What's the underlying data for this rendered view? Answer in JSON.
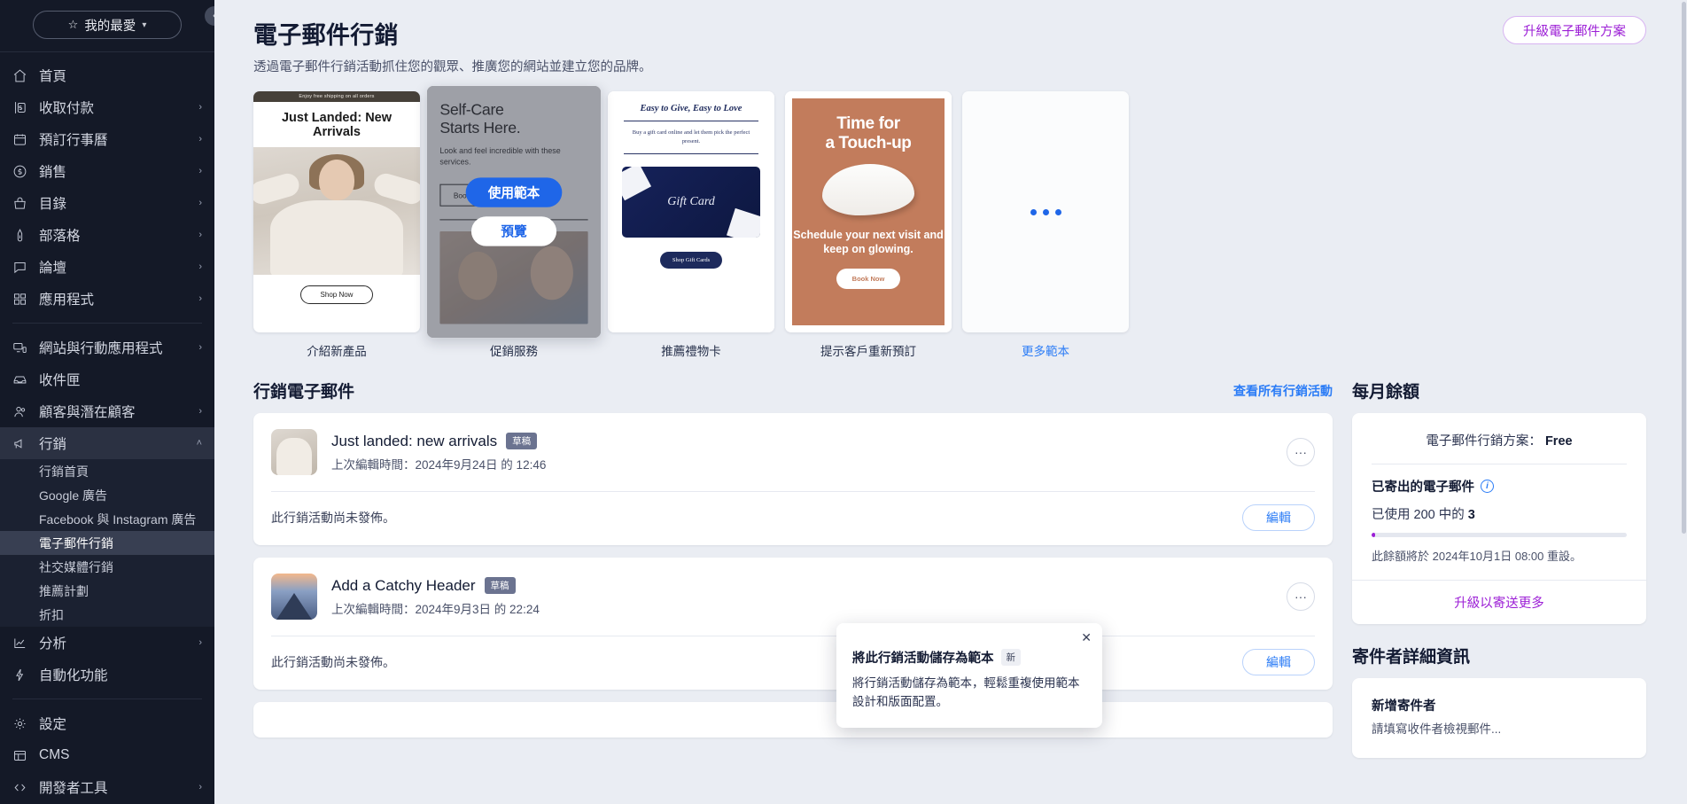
{
  "sidebar": {
    "favorites_label": "我的最愛",
    "favorites_icon": "star-icon",
    "collapse_icon": "chevron-left-icon",
    "items": [
      {
        "label": "首頁",
        "icon": "home-icon",
        "expandable": false
      },
      {
        "label": "收取付款",
        "icon": "receive-payment-icon",
        "expandable": true
      },
      {
        "label": "預訂行事曆",
        "icon": "calendar-icon",
        "expandable": true
      },
      {
        "label": "銷售",
        "icon": "dollar-circle-icon",
        "expandable": true
      },
      {
        "label": "目錄",
        "icon": "catalog-icon",
        "expandable": true
      },
      {
        "label": "部落格",
        "icon": "pen-icon",
        "expandable": true
      },
      {
        "label": "論壇",
        "icon": "forum-icon",
        "expandable": true
      },
      {
        "label": "應用程式",
        "icon": "apps-grid-icon",
        "expandable": true
      }
    ],
    "items2": [
      {
        "label": "網站與行動應用程式",
        "icon": "monitor-mobile-icon",
        "expandable": true
      },
      {
        "label": "收件匣",
        "icon": "inbox-icon",
        "expandable": false
      },
      {
        "label": "顧客與潛在顧客",
        "icon": "people-icon",
        "expandable": true
      },
      {
        "label": "行銷",
        "icon": "megaphone-icon",
        "expandable": true,
        "expanded": true,
        "active": true
      }
    ],
    "marketing_subitems": [
      {
        "label": "行銷首頁",
        "active": false
      },
      {
        "label": "Google 廣告",
        "active": false
      },
      {
        "label": "Facebook 與 Instagram 廣告",
        "active": false
      },
      {
        "label": "電子郵件行銷",
        "active": true
      },
      {
        "label": "社交媒體行銷",
        "active": false
      },
      {
        "label": "推薦計劃",
        "active": false
      },
      {
        "label": "折扣",
        "active": false
      }
    ],
    "items3": [
      {
        "label": "分析",
        "icon": "analytics-icon",
        "expandable": true
      },
      {
        "label": "自動化功能",
        "icon": "automation-bolt-icon",
        "expandable": false
      }
    ],
    "items4": [
      {
        "label": "設定",
        "icon": "gear-icon",
        "expandable": false
      },
      {
        "label": "CMS",
        "icon": "table-icon",
        "expandable": false
      },
      {
        "label": "開發者工具",
        "icon": "code-icon",
        "expandable": true
      }
    ]
  },
  "header": {
    "title": "電子郵件行銷",
    "subtitle": "透過電子郵件行銷活動抓住您的觀眾、推廣您的網站並建立您的品牌。",
    "upgrade_button": "升級電子郵件方案"
  },
  "templates": {
    "use_template_button": "使用範本",
    "preview_button": "預覽",
    "cards": [
      {
        "caption": "介紹新產品",
        "topbar": "Enjoy free shipping on all orders",
        "heading": "Just Landed: New Arrivals",
        "cta": "Shop Now"
      },
      {
        "caption": "促銷服務",
        "heading_line1": "Self-Care",
        "heading_line2": "Starts Here.",
        "body": "Look and feel incredible with these services.",
        "cta": "Book Now",
        "hovered": true
      },
      {
        "caption": "推薦禮物卡",
        "heading": "Easy to Give, Easy to Love",
        "body": "Buy a gift card online and let them pick the perfect present.",
        "card_text": "Gift Card",
        "cta": "Shop Gift Cards"
      },
      {
        "caption": "提示客戶重新預訂",
        "heading_line1": "Time for",
        "heading_line2": "a Touch-up",
        "body": "Schedule your next visit and keep on glowing.",
        "cta": "Book Now"
      },
      {
        "caption": "更多範本",
        "is_link": true,
        "loading": true
      }
    ]
  },
  "campaigns_section": {
    "title": "行銷電子郵件",
    "view_all_link": "查看所有行銷活動",
    "items": [
      {
        "name": "Just landed: new arrivals",
        "badge": "草稿",
        "meta": "上次編輯時間：2024年9月24日 的 12:46",
        "status": "此行銷活動尚未發佈。",
        "edit_button": "編輯",
        "more_icon": "ellipsis-icon"
      },
      {
        "name": "Add a Catchy Header",
        "badge": "草稿",
        "meta": "上次編輯時間：2024年9月3日 的 22:24",
        "status": "此行銷活動尚未發佈。",
        "edit_button": "編輯",
        "more_icon": "ellipsis-icon"
      }
    ]
  },
  "balance_panel": {
    "title": "每月餘額",
    "plan_label": "電子郵件行銷方案：",
    "plan_value": "Free",
    "sent_label": "已寄出的電子郵件",
    "info_icon": "info-icon",
    "used_prefix": "已使用 200 中的",
    "used_value": "3",
    "used_total": 200,
    "used_count": 3,
    "progress_percent": 1.5,
    "reset_note": "此餘額將於 2024年10月1日 08:00 重設。",
    "upgrade_link": "升級以寄送更多",
    "accent_color": "#9c1fd6"
  },
  "sender_panel": {
    "title": "寄件者詳細資訊",
    "heading": "新增寄件者",
    "body": "請填寫收件者檢視郵件..."
  },
  "popover": {
    "title": "將此行銷活動儲存為範本",
    "badge": "新",
    "body": "將行銷活動儲存為範本，輕鬆重複使用範本設計和版面配置。",
    "close_icon": "close-icon"
  }
}
